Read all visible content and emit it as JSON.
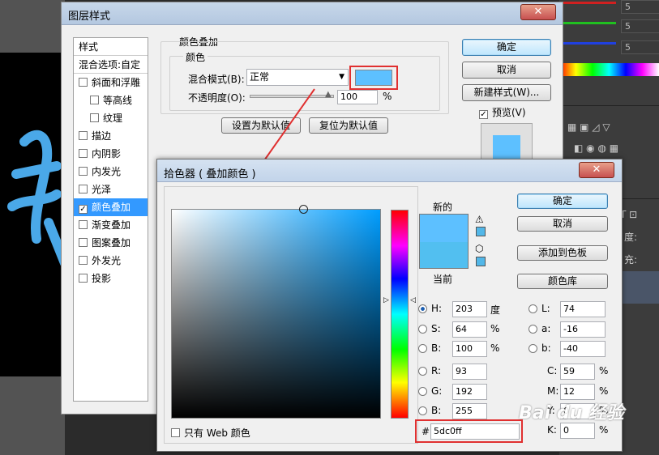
{
  "workspace": {
    "right_values": [
      "5",
      "5",
      "5"
    ],
    "panel_labels": [
      "度:",
      "充:"
    ]
  },
  "layer_style": {
    "title": "图层样式",
    "style_list": [
      {
        "label": "样式",
        "kind": "head"
      },
      {
        "label": "混合选项:自定",
        "kind": "head"
      },
      {
        "label": "斜面和浮雕",
        "checked": false
      },
      {
        "label": "等高线",
        "checked": false,
        "indent": true
      },
      {
        "label": "纹理",
        "checked": false,
        "indent": true
      },
      {
        "label": "描边",
        "checked": false
      },
      {
        "label": "内阴影",
        "checked": false
      },
      {
        "label": "内发光",
        "checked": false
      },
      {
        "label": "光泽",
        "checked": false
      },
      {
        "label": "颜色叠加",
        "checked": true,
        "selected": true
      },
      {
        "label": "渐变叠加",
        "checked": false
      },
      {
        "label": "图案叠加",
        "checked": false
      },
      {
        "label": "外发光",
        "checked": false
      },
      {
        "label": "投影",
        "checked": false
      }
    ],
    "section_title": "颜色叠加",
    "color_group": "颜色",
    "blend_mode_label": "混合模式(B):",
    "blend_mode_value": "正常",
    "opacity_label": "不透明度(O):",
    "opacity_value": "100",
    "opacity_unit": "%",
    "overlay_color": "#5dc0ff",
    "set_default": "设置为默认值",
    "reset_default": "复位为默认值",
    "ok": "确定",
    "cancel": "取消",
    "new_style": "新建样式(W)...",
    "preview_label": "预览(V)",
    "preview_checked": true
  },
  "color_picker": {
    "title": "拾色器 ( 叠加颜色 )",
    "new_label": "新的",
    "current_label": "当前",
    "new_color": "#5dc0ff",
    "current_color": "#52bff0",
    "ok": "确定",
    "cancel": "取消",
    "add_swatch": "添加到色板",
    "color_library": "颜色库",
    "web_only_label": "只有 Web 颜色",
    "hex_prefix": "#",
    "hex_value": "5dc0ff",
    "fields": {
      "H": {
        "value": "203",
        "unit": "度",
        "selected": true
      },
      "S": {
        "value": "64",
        "unit": "%"
      },
      "B": {
        "value": "100",
        "unit": "%"
      },
      "R": {
        "value": "93"
      },
      "G": {
        "value": "192"
      },
      "Bv": {
        "value": "255"
      },
      "L": {
        "value": "74"
      },
      "a": {
        "value": "-16"
      },
      "b": {
        "value": "-40"
      },
      "C": {
        "value": "59",
        "unit": "%"
      },
      "M": {
        "value": "12",
        "unit": "%"
      },
      "Y": {
        "value": "0",
        "unit": "%"
      },
      "K": {
        "value": "0",
        "unit": "%"
      }
    },
    "labels": {
      "H": "H:",
      "S": "S:",
      "B": "B:",
      "R": "R:",
      "G": "G:",
      "Bv": "B:",
      "L": "L:",
      "a": "a:",
      "b": "b:",
      "C": "C:",
      "M": "M:",
      "Y": "Y:",
      "K": "K:"
    }
  },
  "watermark": "Bai du 经验"
}
